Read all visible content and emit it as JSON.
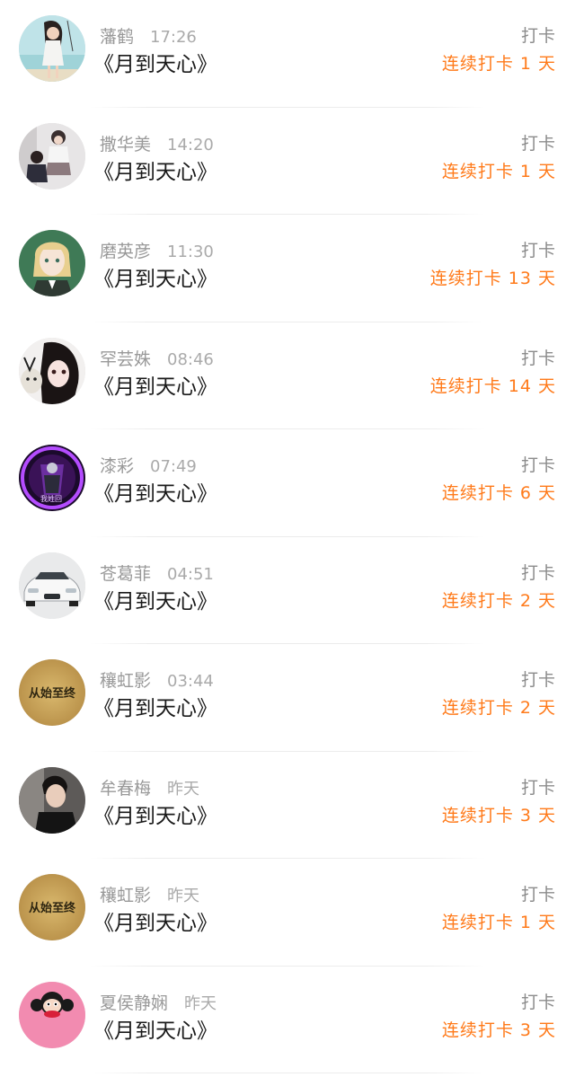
{
  "items": [
    {
      "name": "藩鹤",
      "time": "17:26",
      "title": "《月到天心》",
      "action": "打卡",
      "streak": "连续打卡 1 天",
      "avatar": "girl-beach-avatar"
    },
    {
      "name": "撒华美",
      "time": "14:20",
      "title": "《月到天心》",
      "action": "打卡",
      "streak": "连续打卡 1 天",
      "avatar": "couple-photo-avatar"
    },
    {
      "name": "磨英彦",
      "time": "11:30",
      "title": "《月到天心》",
      "action": "打卡",
      "streak": "连续打卡 13 天",
      "avatar": "anime-blonde-avatar"
    },
    {
      "name": "罕芸姝",
      "time": "08:46",
      "title": "《月到天心》",
      "action": "打卡",
      "streak": "连续打卡 14 天",
      "avatar": "anime-girl-cat-avatar"
    },
    {
      "name": "漆彩",
      "time": "07:49",
      "title": "《月到天心》",
      "action": "打卡",
      "streak": "连续打卡 6 天",
      "avatar": "purple-graphic-avatar"
    },
    {
      "name": "苍葛菲",
      "time": "04:51",
      "title": "《月到天心》",
      "action": "打卡",
      "streak": "连续打卡 2 天",
      "avatar": "white-car-avatar"
    },
    {
      "name": "穰虹影",
      "time": "03:44",
      "title": "《月到天心》",
      "action": "打卡",
      "streak": "连续打卡 2 天",
      "avatar": "text-badge-avatar"
    },
    {
      "name": "牟春梅",
      "time": "昨天",
      "title": "《月到天心》",
      "action": "打卡",
      "streak": "连续打卡 3 天",
      "avatar": "man-portrait-avatar"
    },
    {
      "name": "穰虹影",
      "time": "昨天",
      "title": "《月到天心》",
      "action": "打卡",
      "streak": "连续打卡 1 天",
      "avatar": "text-badge-avatar"
    },
    {
      "name": "夏侯静娴",
      "time": "昨天",
      "title": "《月到天心》",
      "action": "打卡",
      "streak": "连续打卡 3 天",
      "avatar": "monkey-face-avatar"
    }
  ],
  "avatar_text": "从始至终",
  "avatar_text_2": "我姓回",
  "colors": {
    "streak": "#ff7a1a",
    "name": "#999999",
    "title": "#1a1a1a",
    "action": "#8c8c8c"
  }
}
